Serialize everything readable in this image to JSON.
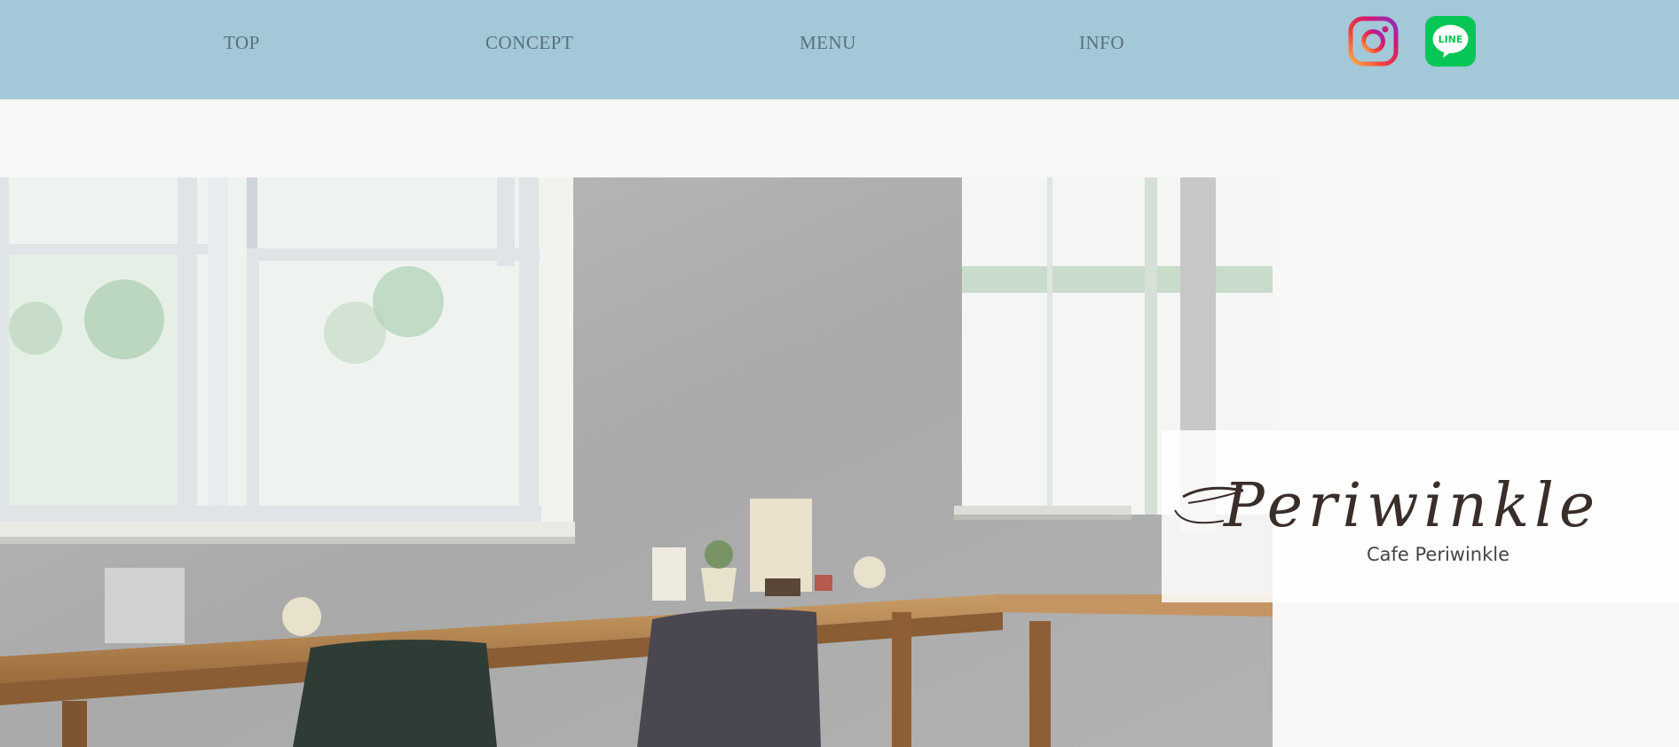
{
  "nav": {
    "items": [
      {
        "label": "TOP"
      },
      {
        "label": "CONCEPT"
      },
      {
        "label": "MENU"
      },
      {
        "label": "INFO"
      }
    ],
    "line_label": "LINE"
  },
  "logo": {
    "script_text": "Periwinkle",
    "subtitle": "Cafe Periwinkle"
  },
  "colors": {
    "header_bg": "#a3c8d8",
    "nav_text": "#5a7079",
    "page_bg": "#f7f7f5",
    "line_green": "#06c755"
  },
  "icons": {
    "instagram": "instagram-icon",
    "line": "line-icon"
  }
}
